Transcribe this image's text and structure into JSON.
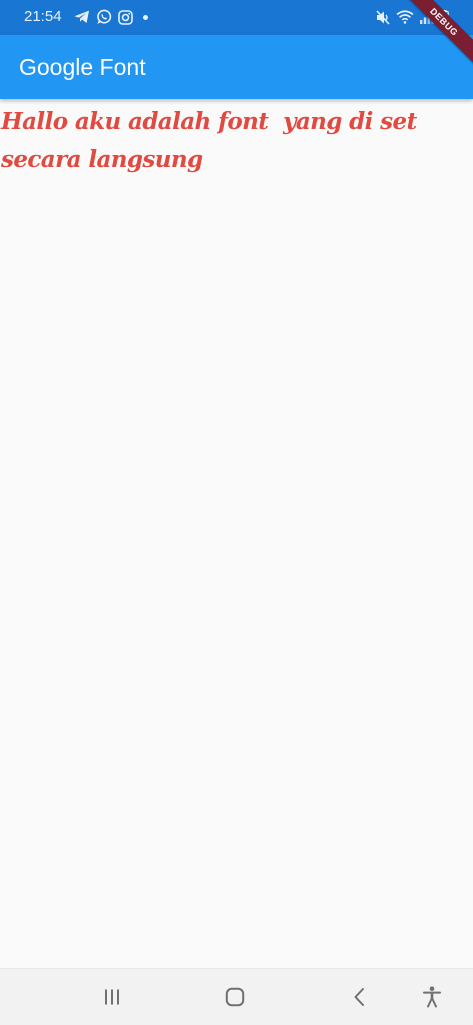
{
  "status_bar": {
    "time": "21:54",
    "left_icons": [
      "telegram-icon",
      "whatsapp-icon",
      "instagram-icon",
      "notification-dot-icon"
    ],
    "right_icons": [
      "mute-icon",
      "wifi-icon",
      "signal-icon",
      "battery-icon"
    ]
  },
  "debug_banner": {
    "label": "DEBUG",
    "color": "#7b1e32"
  },
  "app_bar": {
    "title": "Google Font",
    "color": "#2196f3"
  },
  "body": {
    "text": "Hallo aku adalah font  yang di set secara langsung",
    "color": "#e04a40"
  },
  "nav_bar": {
    "buttons": [
      "recent-apps-icon",
      "home-icon",
      "back-icon",
      "accessibility-icon"
    ]
  }
}
